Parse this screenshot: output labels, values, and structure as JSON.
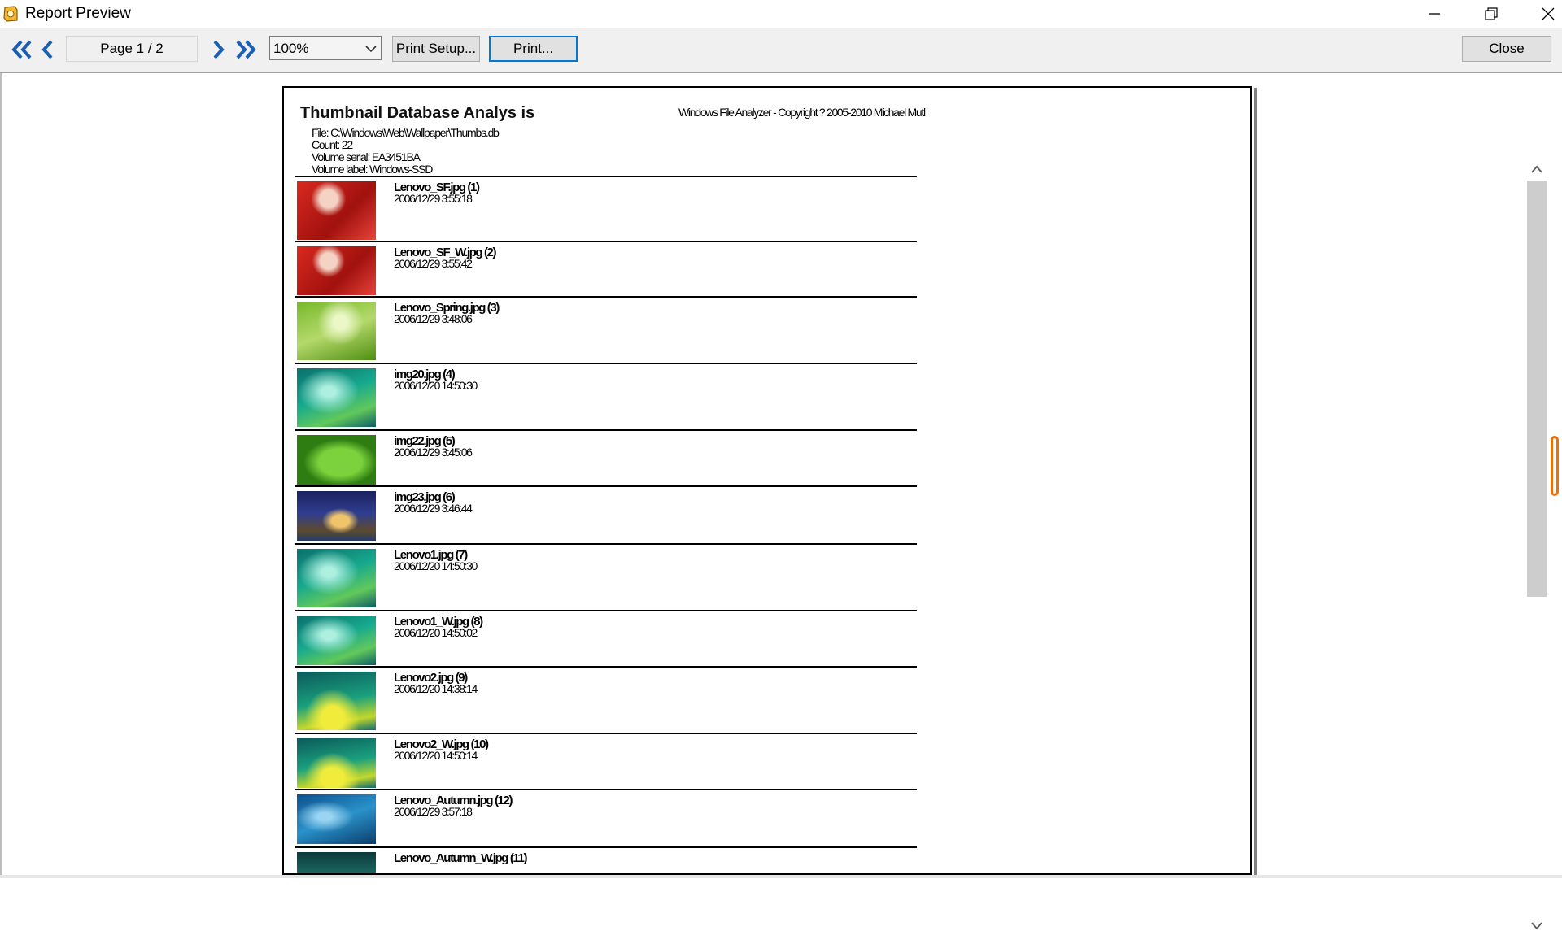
{
  "window": {
    "title": "Report Preview"
  },
  "toolbar": {
    "page_indicator": "Page 1 / 2",
    "zoom": "100%",
    "print_setup_label": "Print Setup...",
    "print_label": "Print...",
    "close_label": "Close"
  },
  "colors": {
    "accent": "#0078d7",
    "nav_icon": "#1a5fb4",
    "scroll_grip": "#e8720c"
  },
  "report": {
    "title": "Thumbnail Database Analys is",
    "copyright": "Windows File Analyzer - Copyright ? 2005-2010 Michael Mutl",
    "file": "File: C:\\Windows\\Web\\Wallpaper\\Thumbs.db",
    "count": "Count: 22",
    "volume_serial": "Volume serial: EA3451BA",
    "volume_label": "Volume label: Windows-SSD",
    "items": [
      {
        "name": "Lenovo_SF.jpg (1)",
        "date": "2006/12/29 3:55:18",
        "thumb": "red"
      },
      {
        "name": "Lenovo_SF_W.jpg (2)",
        "date": "2006/12/29 3:55:42",
        "thumb": "red"
      },
      {
        "name": "Lenovo_Spring.jpg (3)",
        "date": "2006/12/29 3:48:06",
        "thumb": "leaf"
      },
      {
        "name": "img20.jpg (4)",
        "date": "2006/12/20 14:50:30",
        "thumb": "teal"
      },
      {
        "name": "img22.jpg (5)",
        "date": "2006/12/29 3:45:06",
        "thumb": "green-leaf"
      },
      {
        "name": "img23.jpg (6)",
        "date": "2006/12/29 3:46:44",
        "thumb": "night"
      },
      {
        "name": "Lenovo1.jpg (7)",
        "date": "2006/12/20 14:50:30",
        "thumb": "teal"
      },
      {
        "name": "Lenovo1_W.jpg (8)",
        "date": "2006/12/20 14:50:02",
        "thumb": "teal"
      },
      {
        "name": "Lenovo2.jpg (9)",
        "date": "2006/12/20 14:38:14",
        "thumb": "yellow-teal"
      },
      {
        "name": "Lenovo2_W.jpg (10)",
        "date": "2006/12/20 14:50:14",
        "thumb": "yellow-teal"
      },
      {
        "name": "Lenovo_Autumn.jpg (12)",
        "date": "2006/12/29 3:57:18",
        "thumb": "blue"
      },
      {
        "name": "Lenovo_Autumn_W.jpg (11)",
        "date": "",
        "thumb": "dark-teal"
      }
    ]
  }
}
